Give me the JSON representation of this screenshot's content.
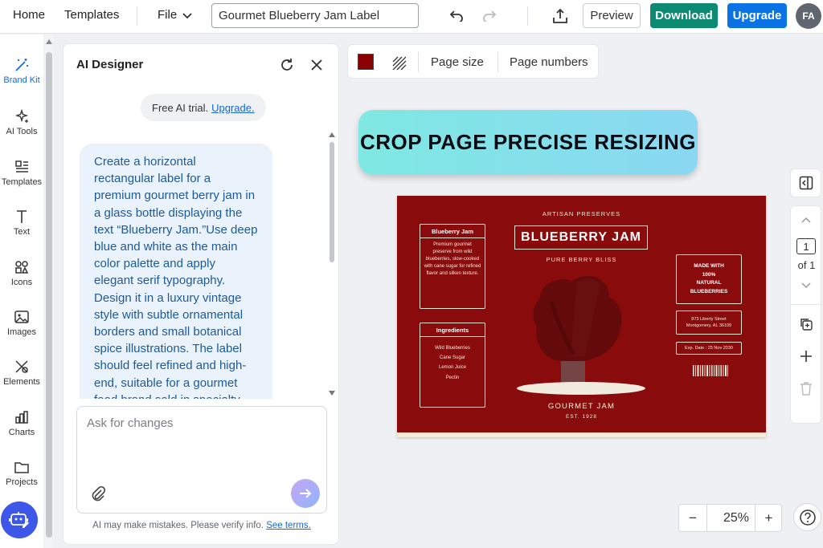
{
  "header": {
    "home": "Home",
    "templates": "Templates",
    "file": "File",
    "doc_title": "Gourmet Blueberry Jam Label",
    "preview": "Preview",
    "download": "Download",
    "upgrade": "Upgrade",
    "avatar": "FA"
  },
  "sidebar": {
    "items": [
      {
        "label": "Brand Kit",
        "icon": "magic-wand-icon"
      },
      {
        "label": "AI Tools",
        "icon": "sparkles-icon"
      },
      {
        "label": "Templates",
        "icon": "templates-icon"
      },
      {
        "label": "Text",
        "icon": "text-icon"
      },
      {
        "label": "Icons",
        "icon": "shapes-icon"
      },
      {
        "label": "Images",
        "icon": "image-icon"
      },
      {
        "label": "Elements",
        "icon": "elements-icon"
      },
      {
        "label": "Charts",
        "icon": "chart-icon"
      },
      {
        "label": "Projects",
        "icon": "folder-icon"
      }
    ]
  },
  "ai_panel": {
    "title": "AI Designer",
    "trial_text": "Free AI trial.",
    "trial_link": "Upgrade.",
    "message": "Create a horizontal rectangular label for a premium gourmet berry jam in a glass bottle displaying the text “Blueberry Jam.”Use deep blue and white as the main color palette and apply elegant serif typography. Design it in a luxury vintage style with subtle ornamental borders and small botanical spice illustrations. The label should feel refined and high-end, suitable for a gourmet food brand sold in specialty",
    "input_placeholder": "Ask for changes",
    "disclaimer": "AI may make mistakes. Please verify info.",
    "disclaimer_link": "See terms."
  },
  "canvas_toolbar": {
    "color": "#8b0000",
    "page_size": "Page size",
    "page_numbers": "Page numbers"
  },
  "banner": {
    "text": "CROP PAGE PRECISE RESIZING"
  },
  "label_design": {
    "background": "#8a0b0b",
    "top_line": "ARTISAN PRESERVES",
    "title": "BLUEBERRY JAM",
    "subtitle": "PURE BERRY BLISS",
    "left_box_title": "Blueberry Jam",
    "left_box_text": "Premium gourmet preserve from wild blueberries, slow-cooked with cane sugar for refined flavor and silken texture.",
    "ingredients_title": "Ingredients",
    "ingredients": [
      "Wild Blueberries",
      "Cane Sugar",
      "Lemon Juice",
      "Pectin"
    ],
    "badge_lines": [
      "MADE WITH",
      "100%",
      "NATURAL",
      "BLUEBERRIES"
    ],
    "address_lines": [
      "873 Liberty Street",
      "Montgomery, AL 36109"
    ],
    "expiry": "Exp. Date : 25 Nov 2030",
    "brand": "GOURMET JAM",
    "established": "EST. 1928"
  },
  "pages": {
    "current": "1",
    "of_label": "of 1"
  },
  "zoom": {
    "minus": "−",
    "value": "25%",
    "plus": "+"
  }
}
